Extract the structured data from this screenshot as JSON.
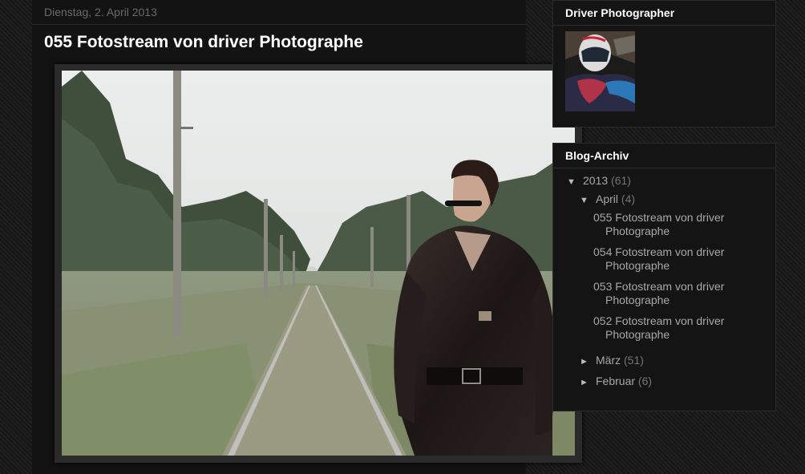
{
  "post": {
    "date": "Dienstag, 2. April 2013",
    "title": "055 Fotostream von driver Photographe"
  },
  "profile_widget": {
    "title": "Driver Photographer"
  },
  "archive_widget": {
    "title": "Blog-Archiv",
    "year": {
      "label": "2013",
      "count": "(61)"
    },
    "month_open": {
      "label": "April",
      "count": "(4)"
    },
    "posts": [
      {
        "line1": "055 Fotostream von driver",
        "line2": "Photographe"
      },
      {
        "line1": "054 Fotostream von driver",
        "line2": "Photographe"
      },
      {
        "line1": "053 Fotostream von driver",
        "line2": "Photographe"
      },
      {
        "line1": "052 Fotostream von driver",
        "line2": "Photographe"
      }
    ],
    "months": [
      {
        "label": "März",
        "count": "(51)"
      },
      {
        "label": "Februar",
        "count": "(6)"
      }
    ],
    "icons": {
      "expanded": "triangle-down-icon",
      "collapsed": "triangle-right-icon"
    }
  }
}
